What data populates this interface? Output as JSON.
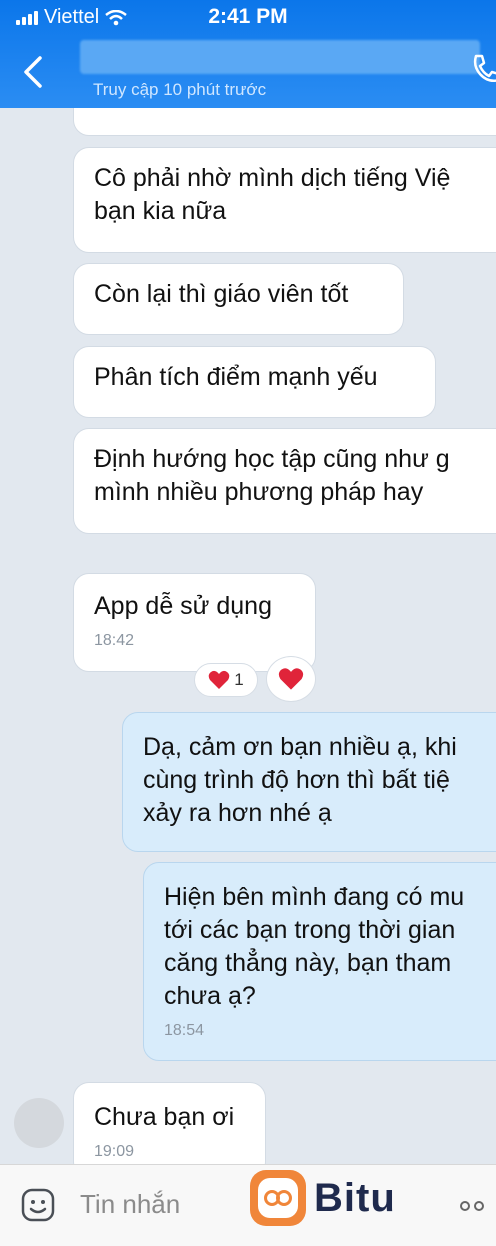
{
  "status_bar": {
    "carrier": "Viettel",
    "time": "2:41 PM"
  },
  "header": {
    "last_seen": "Truy cập 10 phút trước"
  },
  "messages": [
    {
      "lines": [
        "Cô phải nhờ mình dịch tiếng Việ",
        "bạn kia nữa"
      ]
    },
    {
      "lines": [
        "Còn lại thì giáo viên tốt"
      ]
    },
    {
      "lines": [
        "Phân tích điểm mạnh yếu"
      ]
    },
    {
      "lines": [
        "Định hướng học tập cũng như g",
        "mình nhiều phương pháp hay"
      ]
    },
    {
      "lines": [
        "App dễ sử dụng"
      ],
      "time": "18:42",
      "reaction_count": "1"
    },
    {
      "lines": [
        "Dạ, cảm ơn bạn nhiều ạ, khi",
        "cùng trình độ hơn thì bất tiệ",
        "xảy ra hơn nhé ạ"
      ]
    },
    {
      "lines": [
        "Hiện bên mình đang có mu",
        "tới các bạn trong thời gian",
        "căng thẳng này, bạn tham",
        "chưa ạ?"
      ],
      "time": "18:54"
    },
    {
      "lines": [
        "Chưa bạn ơi"
      ],
      "time": "19:09"
    }
  ],
  "input": {
    "placeholder": "Tin nhắn"
  },
  "watermark": {
    "brand": "Bitu"
  }
}
